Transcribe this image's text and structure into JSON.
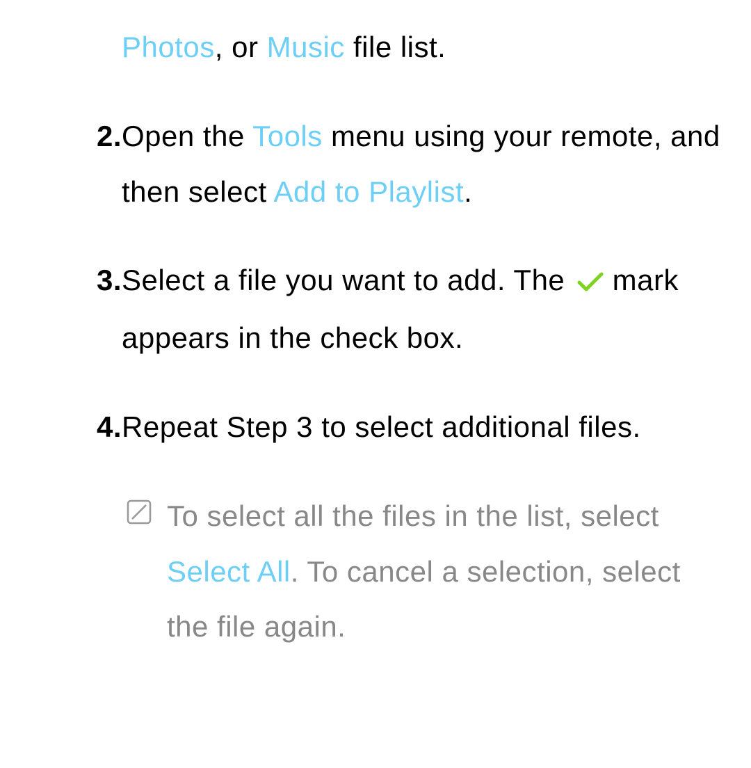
{
  "line1": {
    "photos": "Photos",
    "sep": ", or ",
    "music": "Music",
    "rest": " file list."
  },
  "step2": {
    "num": "2.",
    "p1": "Open the ",
    "tools": "Tools",
    "p2": " menu using your remote, and then select ",
    "add": "Add to Playlist",
    "p3": "."
  },
  "step3": {
    "num": "3.",
    "p1": "Select a file you want to add. The ",
    "p2": " mark appears in the check box."
  },
  "step4": {
    "num": "4.",
    "p1": "Repeat Step 3 to select additional files."
  },
  "note": {
    "p1": "To select all the files in the list, select ",
    "selectall": "Select All",
    "p2": ". To cancel a selection, select the file again."
  }
}
